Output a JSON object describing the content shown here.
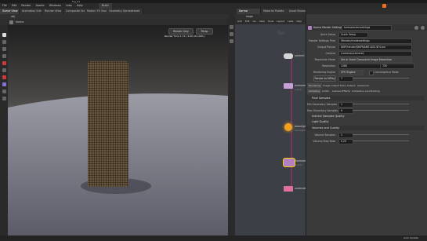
{
  "window": {
    "title": "fog_01"
  },
  "menubar": {
    "items": [
      "File",
      "Edit",
      "Render",
      "Assets",
      "Windows",
      "Labs",
      "Help"
    ],
    "desktop": "Build"
  },
  "viewport_tabs": [
    "Scene View",
    "Animation Editor",
    "Render View",
    "Composite View",
    "Motion FX View",
    "Geometry Spreadsheet"
  ],
  "viewport": {
    "path": "obj",
    "camera": "Karma",
    "camera_label": "Persp",
    "res_label": "Render Only",
    "stats": "Render Time  1.71  / 2.00  (61.29%)"
  },
  "network_tabs": [
    "Karma",
    "Material Palette",
    "Asset Browser"
  ],
  "network": {
    "path": "stage",
    "menu": [
      "Add",
      "Edit",
      "Go",
      "View",
      "Tools",
      "Layout",
      "Labs",
      "Help"
    ],
    "nodes": [
      {
        "name": "sphere1",
        "sub": "",
        "color": "#d6d6d6"
      },
      {
        "name": "karmarender",
        "sub": "1 prim",
        "color": "#c8a0d8"
      },
      {
        "name": "domelight1",
        "sub": "domelight",
        "color": "#f0a020"
      },
      {
        "name": "karmarendersettings",
        "sub": "1 prim",
        "color": "#b080c0"
      },
      {
        "name": "usdrender_rop1",
        "sub": "",
        "color": "#e070a0"
      }
    ]
  },
  "params": {
    "node_type": "Karma Render Settings",
    "node_name": "karmarendersettings",
    "rows": [
      {
        "label": "Quick Setup",
        "value": "Quick Setup"
      },
      {
        "label": "Render Settings Prim",
        "value": "/Render/rendersettings"
      },
      {
        "label": "Output Picture",
        "value": "$HIP/render/$HIPNAME.$OS.$F4.exr"
      },
      {
        "label": "Camera",
        "value": "/cameras/camera1"
      },
      {
        "label": "Resolution Mode",
        "value": "Set or Scale Computed Image Resolution"
      },
      {
        "label": "Resolution",
        "value": "1280",
        "value2": "720"
      },
      {
        "label": "Rendering Engine",
        "value": "CPU Engine"
      },
      {
        "label": "Primary Samples",
        "value": "7"
      }
    ],
    "extra_label": "Convergence Mode",
    "outer_tabs": [
      "Rendering",
      "Image Output",
      "Mono Output",
      "Advanced"
    ],
    "inner_tabs": [
      "Sampling",
      "Limits",
      "Camera Effects",
      "Indirection and Shading"
    ],
    "sections": [
      "Quick Setup",
      "Pixel Samples",
      "Indirect Samples Quality",
      "Light Quality",
      "Volumes and Quality"
    ],
    "sample_rows": [
      {
        "label": "Min Secondary Samples",
        "value": "1"
      },
      {
        "label": "Max Secondary Samples",
        "value": "9"
      },
      {
        "label": "Volume Samples",
        "value": "1"
      },
      {
        "label": "Volume Step Rate",
        "value": "0.25"
      }
    ],
    "button_label": "Render to MPlay",
    "status": "Auto Update"
  },
  "colors": {
    "accent": "#f0a020",
    "selected_node": "#e070a0",
    "wire": "#b03070"
  }
}
